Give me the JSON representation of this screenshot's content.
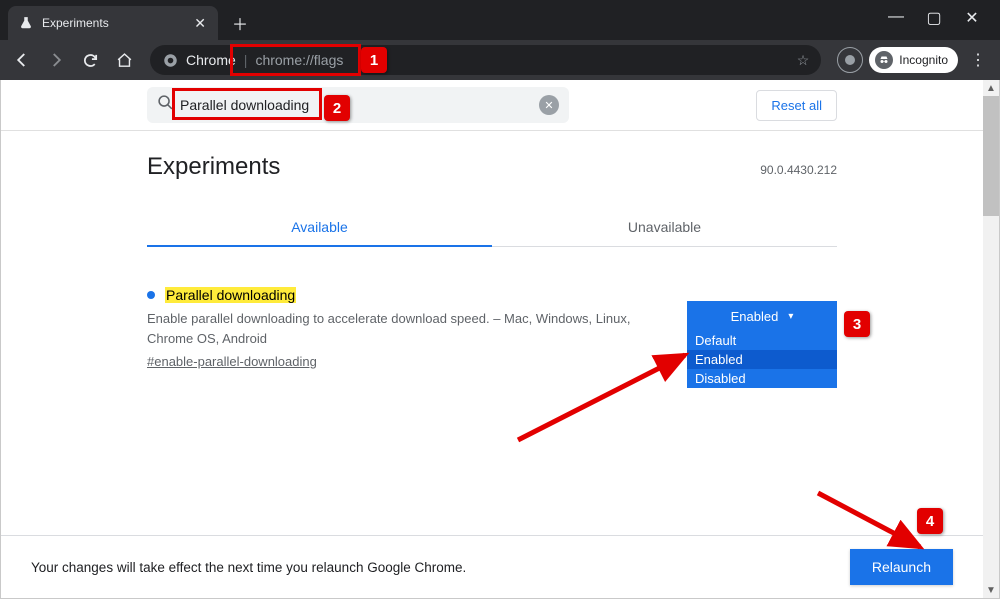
{
  "browser": {
    "tab_title": "Experiments",
    "incognito_label": "Incognito"
  },
  "omnibox": {
    "protocol_label": "Chrome",
    "url_path": "chrome://flags"
  },
  "page": {
    "search_value": "Parallel downloading",
    "reset_label": "Reset all",
    "title": "Experiments",
    "version": "90.0.4430.212",
    "tabs": {
      "available": "Available",
      "unavailable": "Unavailable"
    },
    "flag": {
      "name": "Parallel downloading",
      "description": "Enable parallel downloading to accelerate download speed. – Mac, Windows, Linux, Chrome OS, Android",
      "hash": "#enable-parallel-downloading",
      "selected": "Enabled",
      "options": {
        "o0": "Default",
        "o1": "Enabled",
        "o2": "Disabled"
      }
    }
  },
  "footer": {
    "message": "Your changes will take effect the next time you relaunch Google Chrome.",
    "relaunch": "Relaunch"
  },
  "anno": {
    "b1": "1",
    "b2": "2",
    "b3": "3",
    "b4": "4"
  }
}
